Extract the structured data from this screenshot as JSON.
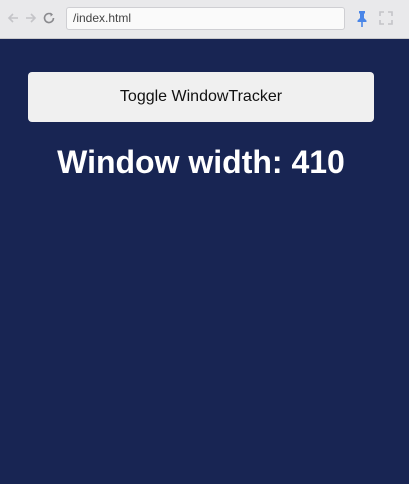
{
  "browser": {
    "url": "/index.html",
    "back_icon": "arrow-left-icon",
    "forward_icon": "arrow-right-icon",
    "reload_icon": "reload-icon",
    "pin_icon": "pin-icon",
    "fullscreen_icon": "fullscreen-icon",
    "accent_color": "#4a86e8"
  },
  "main": {
    "toggle_button_label": "Toggle WindowTracker",
    "heading_label": "Window width:",
    "window_width": "410",
    "background_color": "#182553"
  }
}
